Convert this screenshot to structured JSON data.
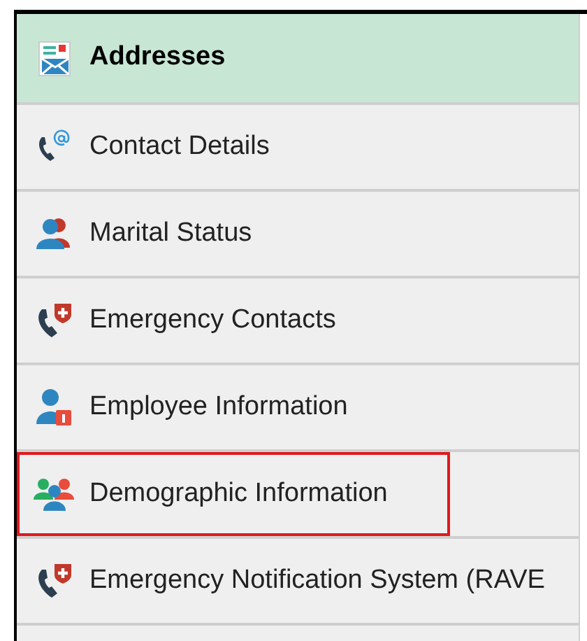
{
  "menu": [
    {
      "label": "Addresses",
      "kind": "addresses",
      "selected": true,
      "outlined": false
    },
    {
      "label": "Contact Details",
      "kind": "phone-at",
      "selected": false,
      "outlined": false
    },
    {
      "label": "Marital Status",
      "kind": "couple",
      "selected": false,
      "outlined": false
    },
    {
      "label": "Emergency Contacts",
      "kind": "phone-cross",
      "selected": false,
      "outlined": false
    },
    {
      "label": "Employee Information",
      "kind": "person-badge",
      "selected": false,
      "outlined": false
    },
    {
      "label": "Demographic Information",
      "kind": "group",
      "selected": false,
      "outlined": true
    },
    {
      "label": "Emergency Notification System (RAVE",
      "kind": "phone-cross",
      "selected": false,
      "outlined": false
    }
  ]
}
